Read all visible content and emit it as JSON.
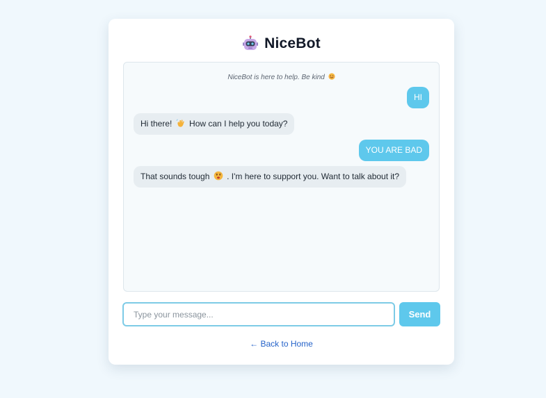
{
  "app": {
    "title": "NiceBot",
    "icon": "robot-icon"
  },
  "chat": {
    "notice": "NiceBot is here to help. Be kind",
    "notice_icon": "smiling-face-icon",
    "messages": [
      {
        "role": "user",
        "text": "HI"
      },
      {
        "role": "bot",
        "text_before": "Hi there!",
        "icon": "waving-hand-icon",
        "text_after": "How can I help you today?"
      },
      {
        "role": "user",
        "text": "YOU ARE BAD"
      },
      {
        "role": "bot",
        "text_before": "That sounds tough",
        "icon": "worried-face-icon",
        "text_after": ". I'm here to support you. Want to talk about it?"
      }
    ]
  },
  "composer": {
    "placeholder": "Type your message...",
    "send_label": "Send"
  },
  "footer": {
    "back_label": "← Back to Home"
  },
  "colors": {
    "accent": "#5ec8ec",
    "page_background": "#f0f8fd",
    "link": "#2563c9"
  }
}
